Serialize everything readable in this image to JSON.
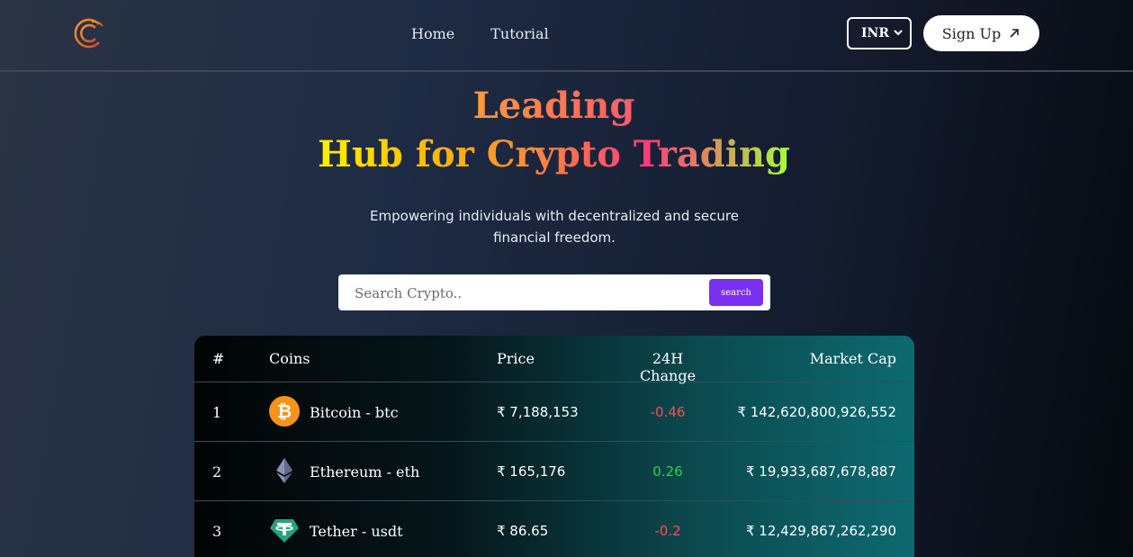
{
  "nav": {
    "links": [
      "Home",
      "Tutorial"
    ],
    "currency": "INR",
    "signup_label": "Sign Up"
  },
  "hero": {
    "title_line1": "Leading",
    "title_line2": "Hub for Crypto Trading",
    "subtitle": "Empowering individuals with decentralized and secure financial freedom."
  },
  "search": {
    "placeholder": "Search Crypto..",
    "button_label": "search"
  },
  "table": {
    "headers": [
      "#",
      "Coins",
      "Price",
      "24H Change",
      "Market Cap"
    ],
    "rows": [
      {
        "rank": "1",
        "coin": "Bitcoin - btc",
        "icon": "bitcoin-icon",
        "price": "₹ 7,188,153",
        "change": "-0.46",
        "market_cap": "₹ 142,620,800,926,552"
      },
      {
        "rank": "2",
        "coin": "Ethereum - eth",
        "icon": "ethereum-icon",
        "price": "₹ 165,176",
        "change": "0.26",
        "market_cap": "₹ 19,933,687,678,887"
      },
      {
        "rank": "3",
        "coin": "Tether - usdt",
        "icon": "tether-icon",
        "price": "₹ 86.65",
        "change": "-0.2",
        "market_cap": "₹ 12,429,867,262,290"
      }
    ]
  },
  "colors": {
    "accent": "#7a2ff2",
    "negative": "#ff4d4d",
    "positive": "#22d64a"
  }
}
